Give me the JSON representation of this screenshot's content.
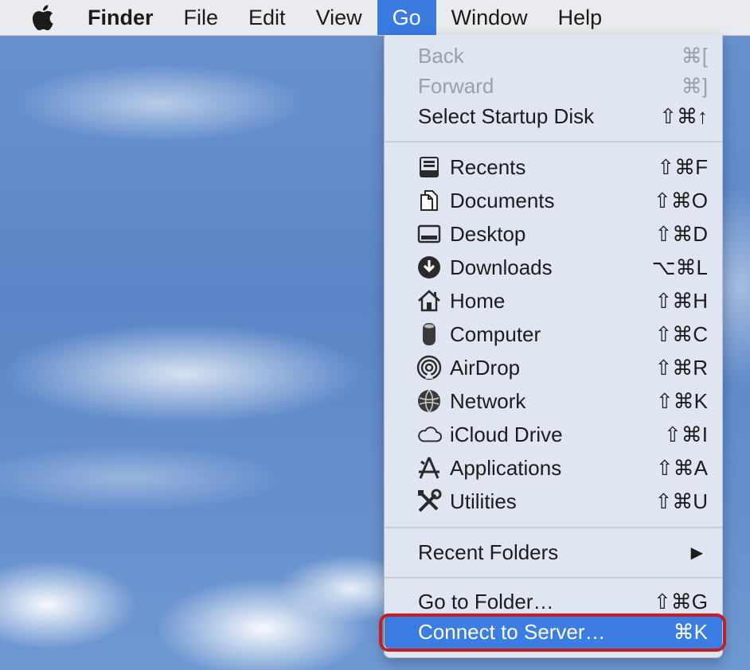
{
  "menubar": {
    "apple_icon": "apple-logo-icon",
    "items": [
      "Finder",
      "File",
      "Edit",
      "View",
      "Go",
      "Window",
      "Help"
    ],
    "active": "Go"
  },
  "go_menu": {
    "group1": [
      {
        "label": "Back",
        "shortcut": "⌘[",
        "enabled": false
      },
      {
        "label": "Forward",
        "shortcut": "⌘]",
        "enabled": false
      },
      {
        "label": "Select Startup Disk",
        "shortcut": "⇧⌘↑",
        "enabled": true
      }
    ],
    "group2": [
      {
        "label": "Recents",
        "shortcut": "⇧⌘F",
        "icon": "recents-icon"
      },
      {
        "label": "Documents",
        "shortcut": "⇧⌘O",
        "icon": "documents-icon"
      },
      {
        "label": "Desktop",
        "shortcut": "⇧⌘D",
        "icon": "desktop-icon"
      },
      {
        "label": "Downloads",
        "shortcut": "⌥⌘L",
        "icon": "downloads-icon"
      },
      {
        "label": "Home",
        "shortcut": "⇧⌘H",
        "icon": "home-icon"
      },
      {
        "label": "Computer",
        "shortcut": "⇧⌘C",
        "icon": "computer-icon"
      },
      {
        "label": "AirDrop",
        "shortcut": "⇧⌘R",
        "icon": "airdrop-icon"
      },
      {
        "label": "Network",
        "shortcut": "⇧⌘K",
        "icon": "network-icon"
      },
      {
        "label": "iCloud Drive",
        "shortcut": "⇧⌘I",
        "icon": "icloud-icon"
      },
      {
        "label": "Applications",
        "shortcut": "⇧⌘A",
        "icon": "applications-icon"
      },
      {
        "label": "Utilities",
        "shortcut": "⇧⌘U",
        "icon": "utilities-icon"
      }
    ],
    "recent_folders": {
      "label": "Recent Folders",
      "submenu_arrow": "▶"
    },
    "go_to_folder": {
      "label": "Go to Folder…",
      "shortcut": "⇧⌘G"
    },
    "connect_to_server": {
      "label": "Connect to Server…",
      "shortcut": "⌘K",
      "highlighted": true
    }
  },
  "colors": {
    "menubar_bg": "#e9ebee",
    "active_menu": "#3a7be0",
    "highlight": "#3b7de2",
    "outline": "#c31f24"
  }
}
